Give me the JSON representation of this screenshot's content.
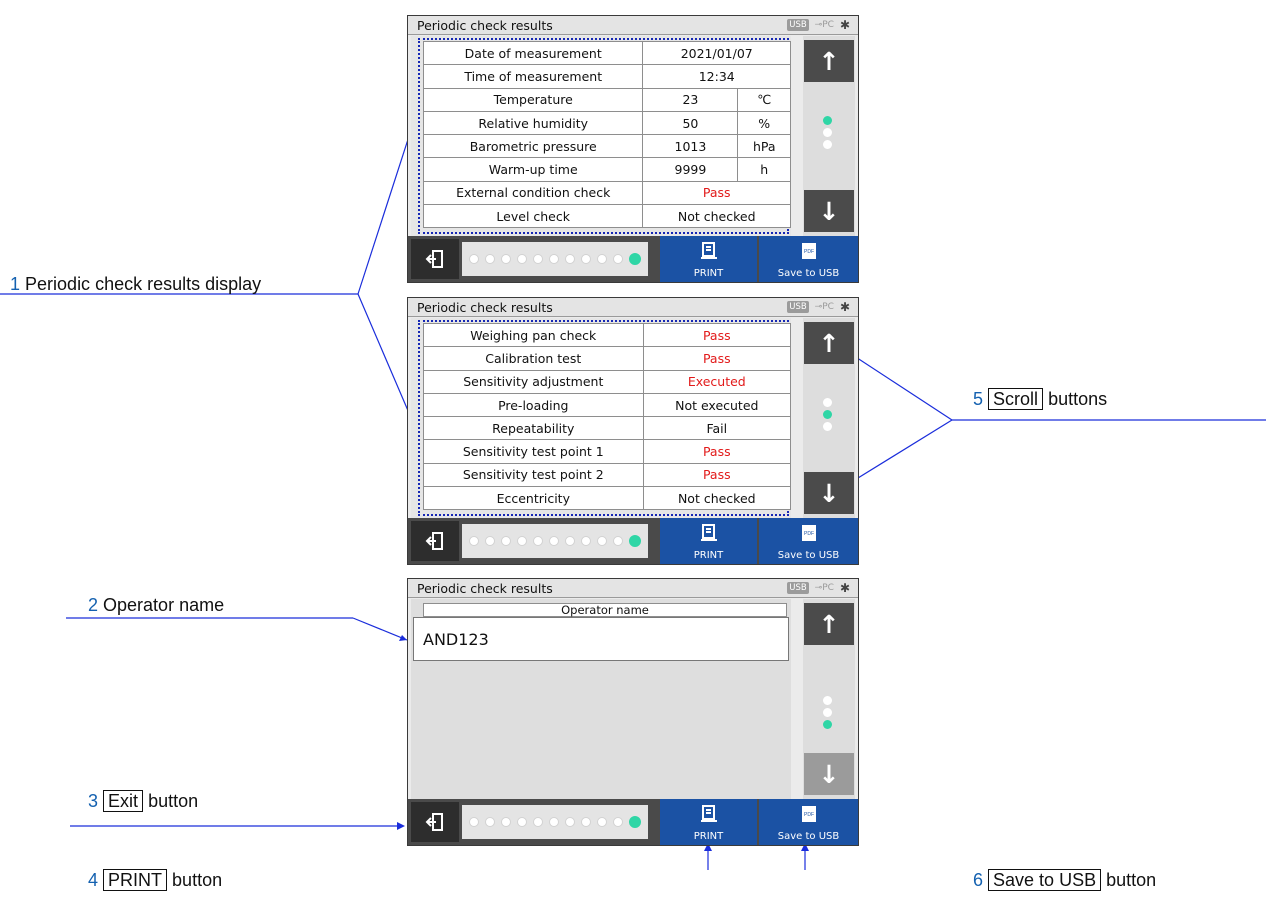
{
  "colors": {
    "accent_blue": "#1b52a4",
    "pass_red": "#e21a1a",
    "indicator_teal": "#2fd6a6",
    "annotation_line": "#1a2ddb"
  },
  "screen_common": {
    "title": "Periodic check results",
    "usb_indicator": "USB",
    "pc_indicator": "PC",
    "bluetooth_icon": "bluetooth-icon",
    "print_label": "PRINT",
    "save_usb_label": "Save to USB",
    "pdf_icon_text": "PDF",
    "scroll_up": "↑",
    "scroll_down": "↓",
    "footer_page_dots": 11,
    "footer_active_dot": 11
  },
  "screen1": {
    "rows": [
      {
        "label": "Date of measurement",
        "value": "2021/01/07"
      },
      {
        "label": "Time of measurement",
        "value": "12:34"
      },
      {
        "label": "Temperature",
        "value": "23",
        "unit": "℃"
      },
      {
        "label": "Relative humidity",
        "value": "50",
        "unit": "%"
      },
      {
        "label": "Barometric pressure",
        "value": "1013",
        "unit": "hPa"
      },
      {
        "label": "Warm-up time",
        "value": "9999",
        "unit": "h"
      },
      {
        "label": "External condition check",
        "value": "Pass"
      },
      {
        "label": "Level check",
        "value": "Not checked"
      }
    ],
    "page_indicator": 1
  },
  "screen2": {
    "rows": [
      {
        "label": "Weighing pan check",
        "value": "Pass"
      },
      {
        "label": "Calibration test",
        "value": "Pass"
      },
      {
        "label": "Sensitivity adjustment",
        "value": "Executed"
      },
      {
        "label": "Pre-loading",
        "value": "Not executed"
      },
      {
        "label": "Repeatability",
        "value": "Fail"
      },
      {
        "label": "Sensitivity test point 1",
        "value": "Pass"
      },
      {
        "label": "Sensitivity test point 2",
        "value": "Pass"
      },
      {
        "label": "Eccentricity",
        "value": "Not checked"
      }
    ],
    "page_indicator": 2
  },
  "screen3": {
    "operator_caption": "Operator name",
    "operator_value": "AND123",
    "page_indicator": 3
  },
  "annotations": {
    "a1": {
      "num": "1",
      "text": "Periodic check results display"
    },
    "a2": {
      "num": "2",
      "text": "Operator name"
    },
    "a3": {
      "num": "3",
      "boxed": "Exit",
      "text": "button"
    },
    "a4": {
      "num": "4",
      "boxed": "PRINT",
      "text": "button"
    },
    "a5": {
      "num": "5",
      "boxed": "Scroll",
      "text": "buttons"
    },
    "a6": {
      "num": "6",
      "boxed": "Save to USB",
      "text": "button"
    }
  }
}
